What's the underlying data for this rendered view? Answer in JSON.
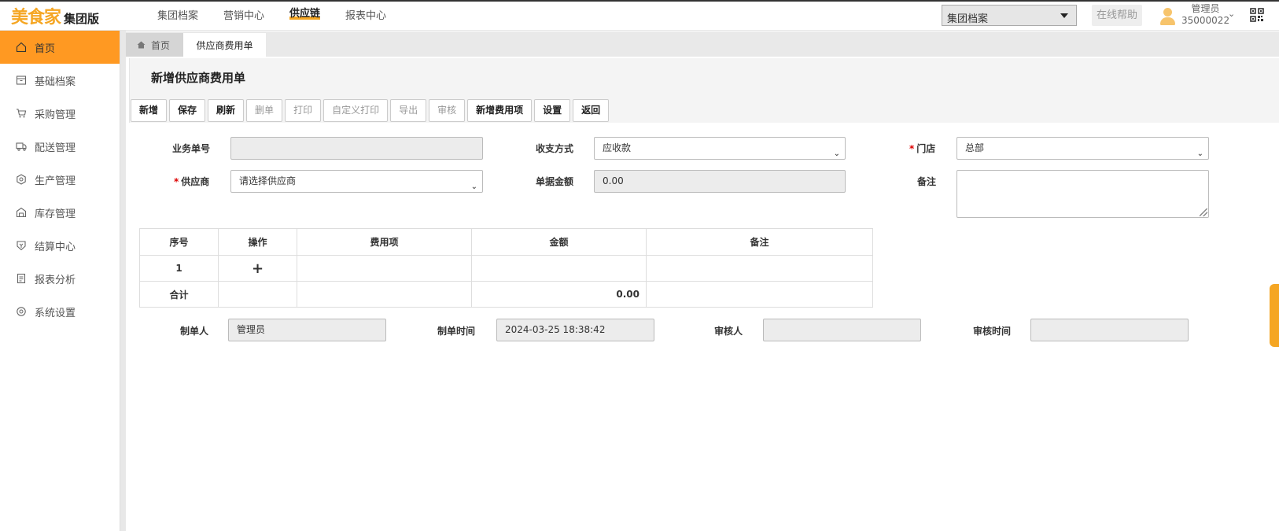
{
  "header": {
    "brand": "美食家",
    "edition": "集团版",
    "nav": [
      "集团档案",
      "营销中心",
      "供应链",
      "报表中心"
    ],
    "nav_active_index": 2,
    "org_select": "集团档案",
    "help": "在线帮助",
    "user_name": "管理员",
    "user_id": "35000022",
    "accent_color": "#f5a623"
  },
  "sidebar": {
    "items": [
      {
        "label": "首页",
        "icon": "home-icon",
        "active": true
      },
      {
        "label": "基础档案",
        "icon": "archive-icon"
      },
      {
        "label": "采购管理",
        "icon": "cart-icon"
      },
      {
        "label": "配送管理",
        "icon": "truck-icon"
      },
      {
        "label": "生产管理",
        "icon": "gear-icon"
      },
      {
        "label": "库存管理",
        "icon": "warehouse-icon"
      },
      {
        "label": "结算中心",
        "icon": "settlement-icon"
      },
      {
        "label": "报表分析",
        "icon": "report-icon"
      },
      {
        "label": "系统设置",
        "icon": "settings-icon"
      }
    ],
    "active_color": "#ff9922"
  },
  "tabs": {
    "home": "首页",
    "current": "供应商费用单"
  },
  "page": {
    "title": "新增供应商费用单",
    "toolbar": [
      {
        "label": "新增",
        "enabled": true
      },
      {
        "label": "保存",
        "enabled": true
      },
      {
        "label": "刷新",
        "enabled": true
      },
      {
        "label": "删单",
        "enabled": false
      },
      {
        "label": "打印",
        "enabled": false
      },
      {
        "label": "自定义打印",
        "enabled": false
      },
      {
        "label": "导出",
        "enabled": false
      },
      {
        "label": "审核",
        "enabled": false
      },
      {
        "label": "新增费用项",
        "enabled": true
      },
      {
        "label": "设置",
        "enabled": true
      },
      {
        "label": "返回",
        "enabled": true
      }
    ]
  },
  "form": {
    "order_no_label": "业务单号",
    "order_no_value": "",
    "payment_label": "收支方式",
    "payment_value": "应收款",
    "store_label": "门店",
    "store_value": "总部",
    "supplier_label": "供应商",
    "supplier_placeholder": "请选择供应商",
    "amount_label": "单据金额",
    "amount_value": "0.00",
    "remark_label": "备注",
    "remark_value": ""
  },
  "table": {
    "headers": [
      "序号",
      "操作",
      "费用项",
      "金额",
      "备注"
    ],
    "rows": [
      {
        "index": "1",
        "action": "+",
        "item": "",
        "amount": "",
        "remark": ""
      }
    ],
    "total_label": "合计",
    "total_amount": "0.00"
  },
  "footer": {
    "creator_label": "制单人",
    "creator_value": "管理员",
    "created_time_label": "制单时间",
    "created_time_value": "2024-03-25 18:38:42",
    "auditor_label": "审核人",
    "auditor_value": "",
    "audit_time_label": "审核时间",
    "audit_time_value": ""
  }
}
